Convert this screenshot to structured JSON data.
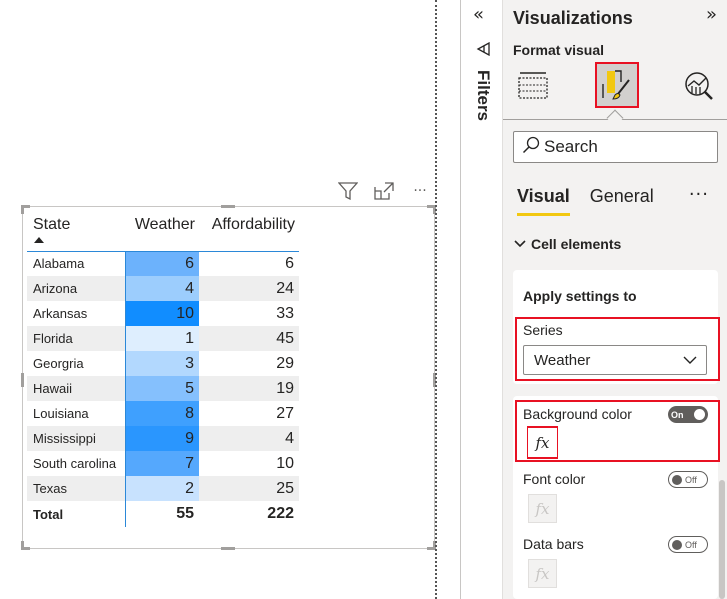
{
  "visual": {
    "header_icons": [
      "filter-icon",
      "focus-mode-icon",
      "more-options-icon"
    ],
    "more_label": "···",
    "columns": [
      "State",
      "Weather",
      "Affordability"
    ],
    "sort": {
      "column": "State",
      "direction": "ascending"
    },
    "rows": [
      {
        "state": "Alabama",
        "weather": 6,
        "affordability": 6,
        "weather_bg": "#6cb2fc"
      },
      {
        "state": "Arizona",
        "weather": 4,
        "affordability": 24,
        "weather_bg": "#9ccdfd"
      },
      {
        "state": "Arkansas",
        "weather": 10,
        "affordability": 33,
        "weather_bg": "#118dff"
      },
      {
        "state": "Florida",
        "weather": 1,
        "affordability": 45,
        "weather_bg": "#deeefe"
      },
      {
        "state": "Georgria",
        "weather": 3,
        "affordability": 29,
        "weather_bg": "#b2d8fe"
      },
      {
        "state": "Hawaii",
        "weather": 5,
        "affordability": 19,
        "weather_bg": "#85c0fd"
      },
      {
        "state": "Louisiana",
        "weather": 8,
        "affordability": 27,
        "weather_bg": "#3fa0fe"
      },
      {
        "state": "Mississippi",
        "weather": 9,
        "affordability": 4,
        "weather_bg": "#2a96fe"
      },
      {
        "state": "South carolina",
        "weather": 7,
        "affordability": 10,
        "weather_bg": "#55a8fd"
      },
      {
        "state": "Texas",
        "weather": 2,
        "affordability": 25,
        "weather_bg": "#c8e2fe"
      }
    ],
    "total": {
      "label": "Total",
      "weather": 55,
      "affordability": 222
    }
  },
  "filters": {
    "collapse_glyph": "«",
    "label": "Filters"
  },
  "viz_pane": {
    "title": "Visualizations",
    "expand_glyph": "»",
    "subtitle": "Format visual",
    "icons": [
      "build-visual-icon",
      "format-visual-icon",
      "analytics-icon"
    ],
    "selected_icon": "format-visual-icon",
    "search_placeholder": "Search",
    "tabs": [
      {
        "label": "Visual",
        "active": true
      },
      {
        "label": "General",
        "active": false
      }
    ],
    "more_label": "···",
    "section": "Cell elements",
    "apply_settings_title": "Apply settings to",
    "series_label": "Series",
    "series_value": "Weather",
    "properties": [
      {
        "label": "Background color",
        "toggle": "On",
        "enabled": true
      },
      {
        "label": "Font color",
        "toggle": "Off",
        "enabled": false
      },
      {
        "label": "Data bars",
        "toggle": "Off",
        "enabled": false
      }
    ],
    "fx_label": "fx",
    "highlight_color": "#e81123",
    "accent_color": "#f2c811"
  }
}
